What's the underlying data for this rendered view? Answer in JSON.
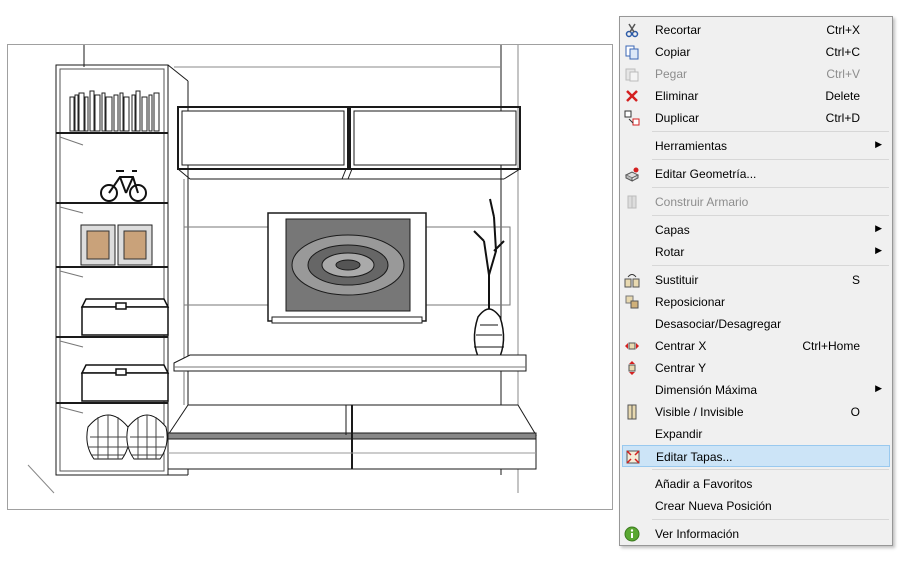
{
  "context_menu": {
    "items": [
      {
        "label": "Recortar",
        "shortcut": "Ctrl+X",
        "icon": "scissors-icon",
        "enabled": true
      },
      {
        "label": "Copiar",
        "shortcut": "Ctrl+C",
        "icon": "copy-icon",
        "enabled": true
      },
      {
        "label": "Pegar",
        "shortcut": "Ctrl+V",
        "icon": "paste-icon",
        "enabled": false
      },
      {
        "label": "Eliminar",
        "shortcut": "Delete",
        "icon": "delete-x-icon",
        "enabled": true
      },
      {
        "label": "Duplicar",
        "shortcut": "Ctrl+D",
        "icon": "duplicate-icon",
        "enabled": true
      },
      {
        "label": "Herramientas",
        "submenu": true,
        "enabled": true
      },
      {
        "label": "Editar Geometría...",
        "icon": "edit-geometry-icon",
        "enabled": true
      },
      {
        "label": "Construir Armario",
        "icon": "build-wardrobe-icon",
        "enabled": false
      },
      {
        "label": "Capas",
        "submenu": true,
        "enabled": true
      },
      {
        "label": "Rotar",
        "submenu": true,
        "enabled": true
      },
      {
        "label": "Sustituir",
        "shortcut": "S",
        "icon": "replace-icon",
        "enabled": true
      },
      {
        "label": "Reposicionar",
        "icon": "reposition-icon",
        "enabled": true
      },
      {
        "label": "Desasociar/Desagregar",
        "enabled": true
      },
      {
        "label": "Centrar X",
        "shortcut": "Ctrl+Home",
        "icon": "center-x-icon",
        "enabled": true
      },
      {
        "label": "Centrar Y",
        "icon": "center-y-icon",
        "enabled": true
      },
      {
        "label": "Dimensión Máxima",
        "submenu": true,
        "enabled": true
      },
      {
        "label": "Visible / Invisible",
        "shortcut": "O",
        "icon": "visibility-icon",
        "enabled": true
      },
      {
        "label": "Expandir",
        "enabled": true
      },
      {
        "label": "Editar Tapas...",
        "icon": "edit-covers-icon",
        "enabled": true,
        "highlighted": true
      },
      {
        "label": "Añadir a Favoritos",
        "enabled": true
      },
      {
        "label": "Crear Nueva Posición",
        "enabled": true
      },
      {
        "label": "Ver Información",
        "icon": "info-icon",
        "enabled": true
      }
    ]
  },
  "colors": {
    "menu_bg": "#f0f0f0",
    "highlight_bg": "#cce4f7",
    "highlight_border": "#99c9ef",
    "disabled_text": "#8d8d8d",
    "accent_red": "#d42020"
  }
}
